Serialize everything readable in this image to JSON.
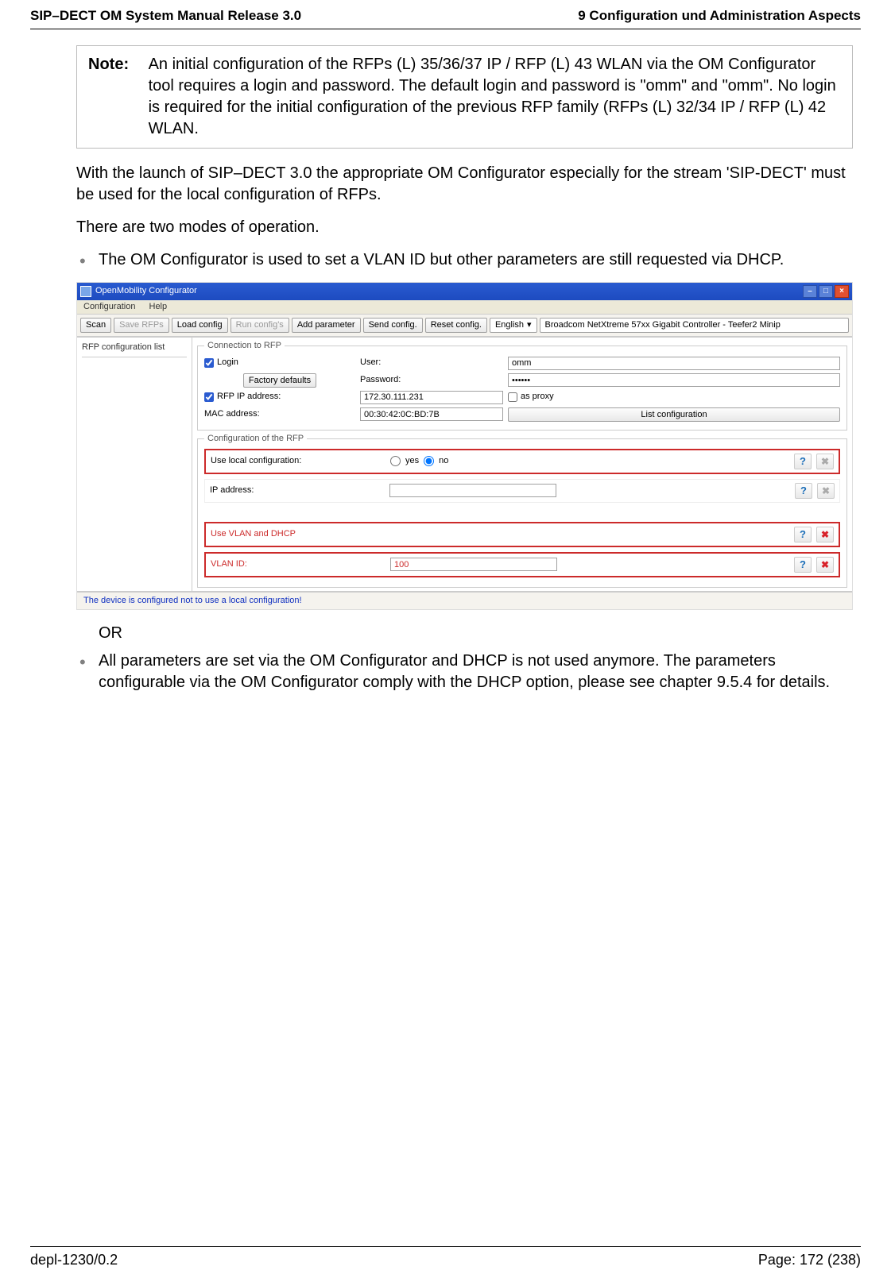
{
  "header": {
    "left": "SIP–DECT OM System Manual Release 3.0",
    "right": "9 Configuration und Administration Aspects"
  },
  "note": {
    "label": "Note:",
    "text": "An initial configuration of the RFPs (L) 35/36/37 IP / RFP (L) 43 WLAN via the OM Configurator tool requires a login and password. The default login and password is \"omm\" and \"omm\". No login is required for the initial configuration of the previous RFP family (RFPs (L) 32/34 IP / RFP (L) 42 WLAN."
  },
  "para1": "With the launch of SIP–DECT 3.0 the appropriate OM Configurator especially for the stream 'SIP-DECT' must be used for the local configuration of RFPs.",
  "para2": "There are two modes of operation.",
  "bullet1": "The OM Configurator is used to set a VLAN ID but other parameters are still requested via DHCP.",
  "or_text": "OR",
  "bullet2": "All parameters are set via the OM Configurator and DHCP is not used anymore. The parameters configurable via the OM Configurator comply with the DHCP option, please see chapter 9.5.4 for details.",
  "app": {
    "title": "OpenMobility Configurator",
    "menu": {
      "configuration": "Configuration",
      "help": "Help"
    },
    "toolbar": {
      "scan": "Scan",
      "save_rfps": "Save RFPs",
      "load_config": "Load config",
      "run_configs": "Run config's",
      "add_parameter": "Add parameter",
      "send_config": "Send config.",
      "reset_config": "Reset config.",
      "language": "English",
      "nic": "Broadcom NetXtreme 57xx Gigabit Controller - Teefer2 Minip"
    },
    "left_panel_title": "RFP configuration list",
    "groups": {
      "connection_title": "Connection to RFP",
      "config_title": "Configuration of the RFP"
    },
    "fields": {
      "login_label": "Login",
      "factory_defaults_btn": "Factory defaults",
      "user_label": "User:",
      "user_value": "omm",
      "password_label": "Password:",
      "password_value": "••••••",
      "rfp_ip_label": "RFP IP address:",
      "rfp_ip_value": "172.30.111.231",
      "as_proxy_label": "as proxy",
      "mac_label": "MAC address:",
      "mac_value": "00:30:42:0C:BD:7B",
      "list_config_btn": "List configuration",
      "use_local_label": "Use local configuration:",
      "yes": "yes",
      "no": "no",
      "ip_address_label": "IP address:",
      "vlan_dhcp_label": "Use VLAN and DHCP",
      "vlan_id_label": "VLAN ID:",
      "vlan_id_value": "100"
    },
    "status": "The device is configured not to use a local configuration!"
  },
  "footer": {
    "left": "depl-1230/0.2",
    "right": "Page: 172 (238)"
  }
}
